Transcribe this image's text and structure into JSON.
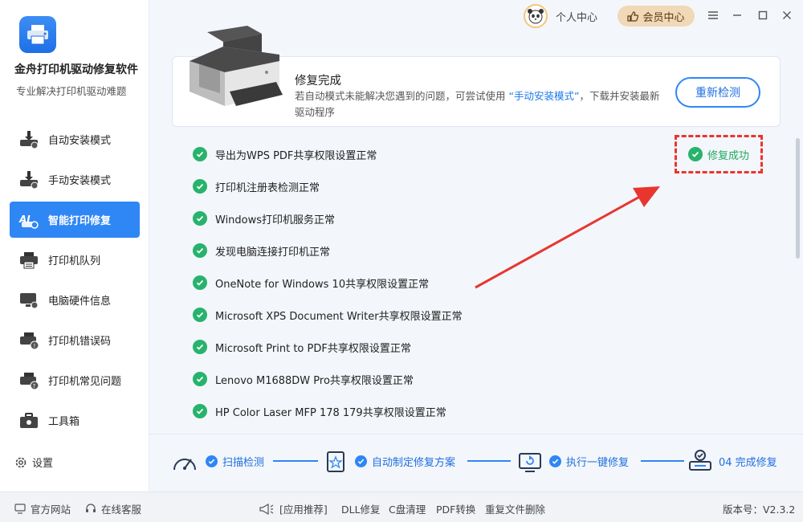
{
  "app": {
    "name": "金舟打印机驱动修复软件",
    "subtitle": "专业解决打印机驱动难题"
  },
  "topbar": {
    "user_label": "个人中心",
    "vip_label": "会员中心"
  },
  "sidebar": {
    "items": [
      {
        "label": "自动安装模式",
        "icon": "printer-download-icon"
      },
      {
        "label": "手动安装模式",
        "icon": "printer-manual-icon"
      },
      {
        "label": "智能打印修复",
        "icon": "ai-repair-icon",
        "active": true
      },
      {
        "label": "打印机队列",
        "icon": "printer-queue-icon"
      },
      {
        "label": "电脑硬件信息",
        "icon": "monitor-info-icon"
      },
      {
        "label": "打印机错误码",
        "icon": "printer-error-icon"
      },
      {
        "label": "打印机常见问题",
        "icon": "printer-faq-icon"
      },
      {
        "label": "工具箱",
        "icon": "toolbox-icon"
      }
    ],
    "settings_label": "设置"
  },
  "summary": {
    "title": "修复完成",
    "desc_before": "若自动模式未能解决您遇到的问题，可尝试使用 ",
    "desc_link": "“手动安装模式”",
    "desc_after": "，下载并安装最新驱动程序",
    "recheck_label": "重新检测"
  },
  "results": [
    "导出为WPS PDF共享权限设置正常",
    "打印机注册表检测正常",
    "Windows打印机服务正常",
    "发现电脑连接打印机正常",
    "OneNote for Windows 10共享权限设置正常",
    "Microsoft XPS Document Writer共享权限设置正常",
    "Microsoft Print to PDF共享权限设置正常",
    "Lenovo M1688DW Pro共享权限设置正常",
    "HP Color Laser MFP 178 179共享权限设置正常"
  ],
  "success_label": "修复成功",
  "steps": [
    {
      "label": "扫描检测",
      "icon": "gauge-icon"
    },
    {
      "label": "自动制定修复方案",
      "icon": "plan-icon"
    },
    {
      "label": "执行一键修复",
      "icon": "repair-icon"
    },
    {
      "label": "04 完成修复",
      "icon": "complete-icon"
    }
  ],
  "statusbar": {
    "website": "官方网站",
    "support": "在线客服",
    "recommend": "[应用推荐]",
    "links": [
      "DLL修复",
      "C盘清理",
      "PDF转换",
      "重复文件删除"
    ],
    "version": "版本号：V2.3.2"
  },
  "colors": {
    "accent": "#2f86f5",
    "success": "#27b36b",
    "highlight": "#e8362f"
  }
}
